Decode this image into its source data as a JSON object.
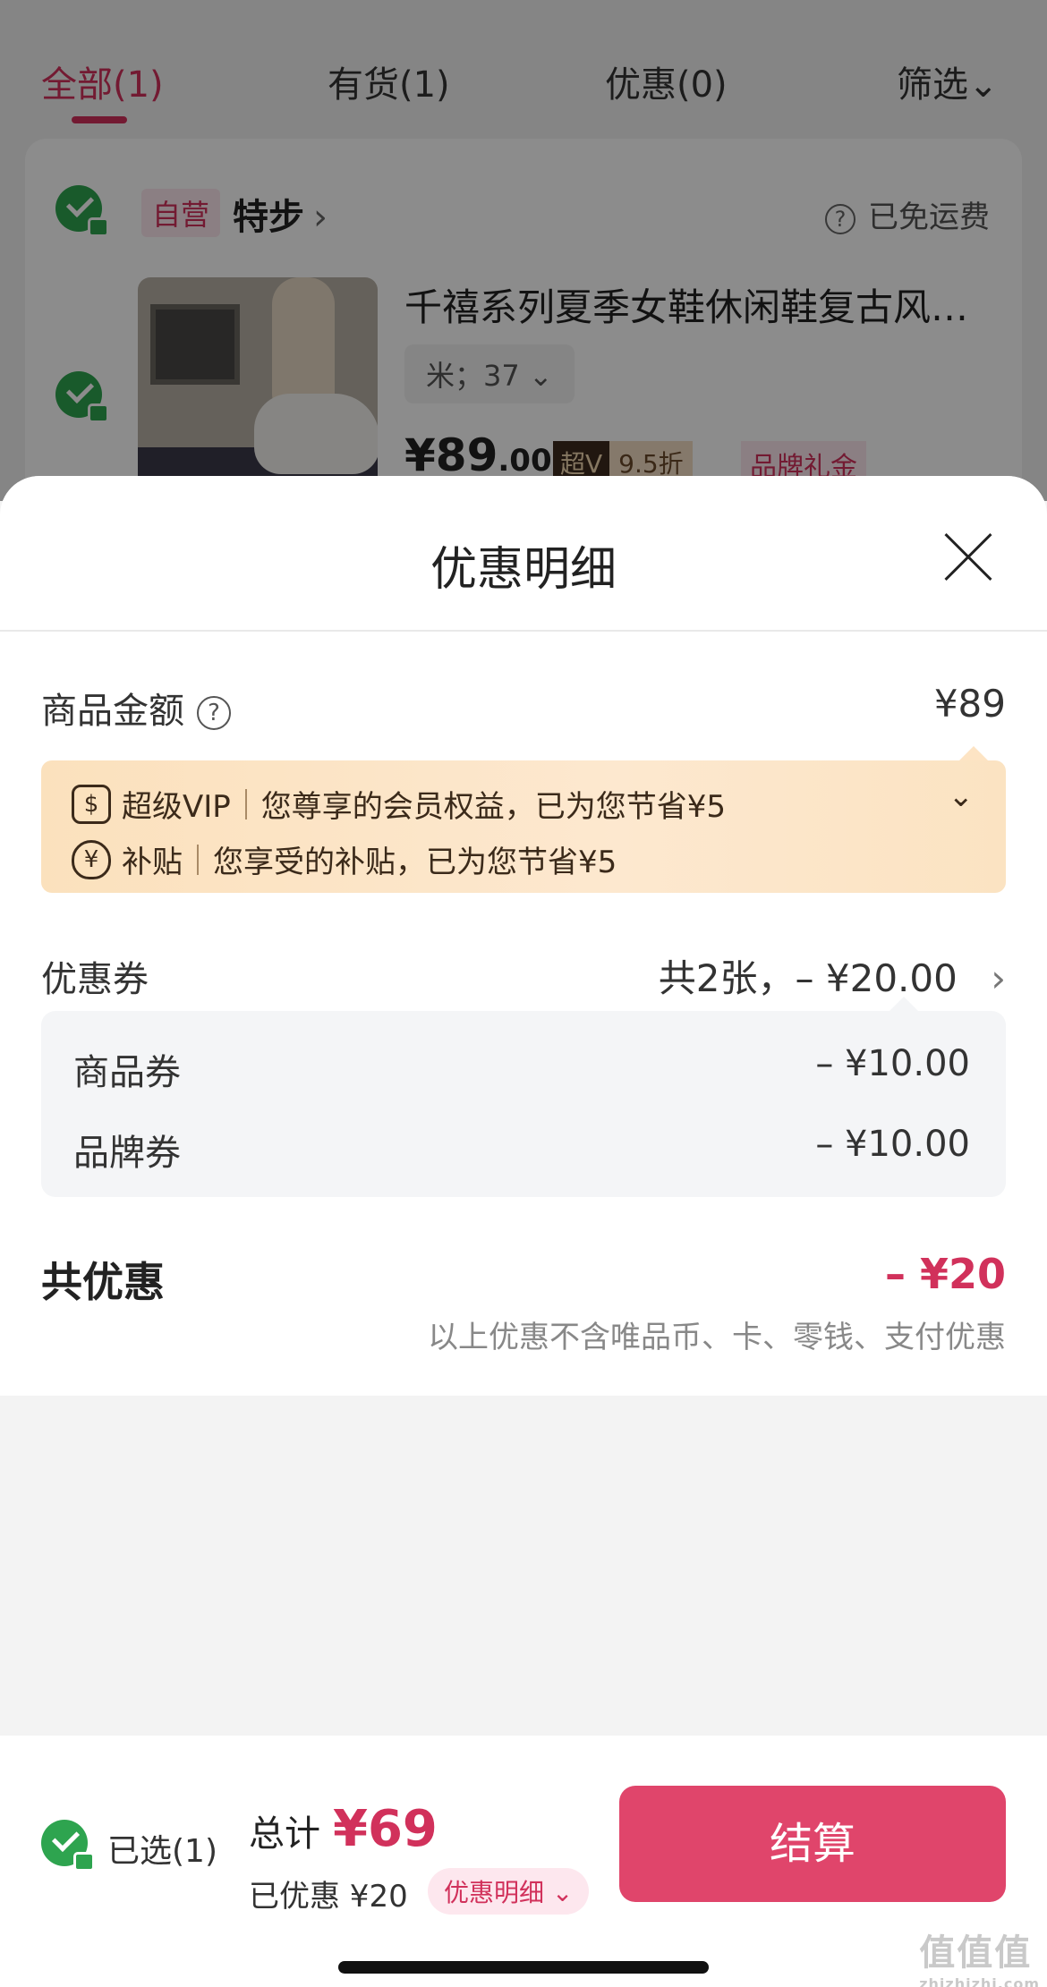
{
  "background": {
    "tabs": [
      {
        "label": "全部(1)"
      },
      {
        "label": "有货(1)"
      },
      {
        "label": "优惠(0)"
      },
      {
        "label": "筛选"
      }
    ],
    "shop": {
      "self_operated": "自营",
      "brand": "特步",
      "shipping": "已免运费"
    },
    "product": {
      "title": "千禧系列夏季女鞋休闲鞋复古风…",
      "sku": "米；37",
      "price_int": "¥89",
      "price_dec": ".00",
      "svip_tag": "超V",
      "svip_discount": "9.5折",
      "gift_tag": "品牌礼金"
    }
  },
  "sheet": {
    "title": "优惠明细",
    "goods_amount_label": "商品金额",
    "goods_amount_value": "¥89",
    "vip": {
      "line1_badge": "超级VIP",
      "line1_text": "您尊享的会员权益，已为您节省¥5",
      "line2_badge": "补贴",
      "line2_text": "您享受的补贴，已为您节省¥5"
    },
    "coupon_label": "优惠券",
    "coupon_summary": "共2张，– ¥20.00",
    "coupons": [
      {
        "name": "商品券",
        "value": "– ¥10.00"
      },
      {
        "name": "品牌券",
        "value": "– ¥10.00"
      }
    ],
    "total_label": "共优惠",
    "total_value": "– ¥20",
    "note": "以上优惠不含唯品币、卡、零钱、支付优惠"
  },
  "footer": {
    "selected": "已选(1)",
    "total_label": "总计",
    "total_value": "¥69",
    "saved": "已优惠 ¥20",
    "detail_pill": "优惠明细",
    "checkout": "结算"
  },
  "watermark": {
    "main": "值值值",
    "sub": "zhizhizhi.com"
  },
  "colors": {
    "accent": "#d1315b",
    "checkout": "#e0456b",
    "check": "#2ea44f"
  }
}
